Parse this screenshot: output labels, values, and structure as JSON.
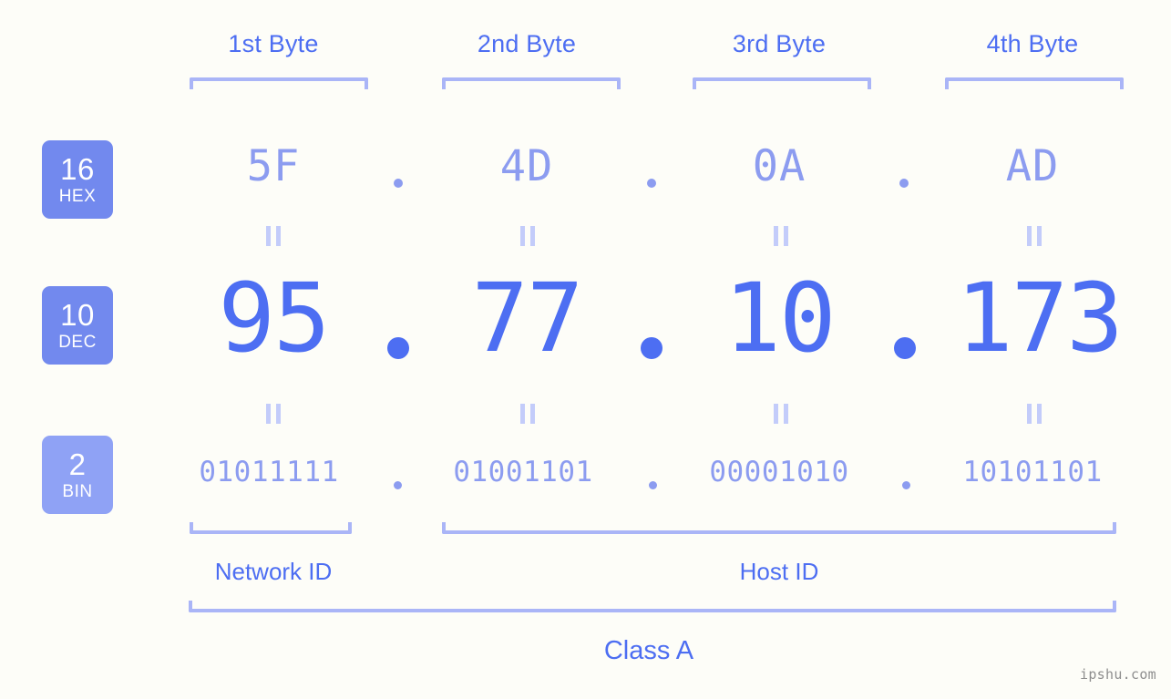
{
  "background_color": "#fdfdf8",
  "colors": {
    "accent_dark": "#4d6ef2",
    "accent_mid": "#8c9cf0",
    "accent_light": "#aab5f7",
    "badge_hex": "#7289ee",
    "badge_dec": "#7289ee",
    "badge_bin": "#8fa2f5",
    "equals_mark": "#c3ccfa",
    "watermark": "#8e8e8e"
  },
  "byte_headers": [
    {
      "label": "1st Byte"
    },
    {
      "label": "2nd Byte"
    },
    {
      "label": "3rd Byte"
    },
    {
      "label": "4th Byte"
    }
  ],
  "radix_badges": [
    {
      "number": "16",
      "name": "HEX"
    },
    {
      "number": "10",
      "name": "DEC"
    },
    {
      "number": "2",
      "name": "BIN"
    }
  ],
  "separator": ".",
  "rows": {
    "hex": {
      "values": [
        "5F",
        "4D",
        "0A",
        "AD"
      ]
    },
    "dec": {
      "values": [
        "95",
        "77",
        "10",
        "173"
      ]
    },
    "bin": {
      "values": [
        "01011111",
        "01001101",
        "00001010",
        "10101101"
      ]
    }
  },
  "equals_marks": [
    {
      "symbol": "="
    },
    {
      "symbol": "="
    },
    {
      "symbol": "="
    },
    {
      "symbol": "="
    },
    {
      "symbol": "="
    },
    {
      "symbol": "="
    },
    {
      "symbol": "="
    },
    {
      "symbol": "="
    }
  ],
  "id_sections": [
    {
      "label": "Network ID"
    },
    {
      "label": "Host ID"
    }
  ],
  "class_section": {
    "label": "Class A"
  },
  "watermark": {
    "text": "ipshu.com"
  }
}
